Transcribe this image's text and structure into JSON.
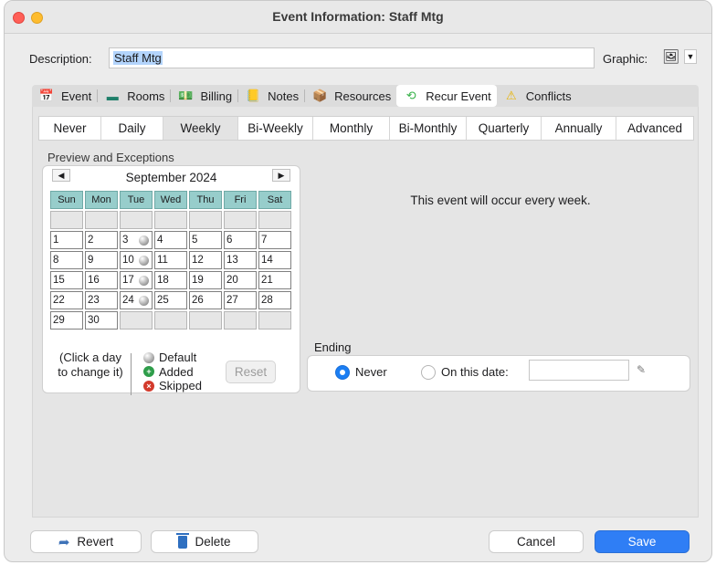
{
  "window": {
    "title": "Event Information: Staff Mtg"
  },
  "description": {
    "label": "Description:",
    "value": "Staff Mtg"
  },
  "graphic": {
    "label": "Graphic:"
  },
  "tabs": [
    {
      "label": "Event",
      "icon": "calendar-31-icon"
    },
    {
      "label": "Rooms",
      "icon": "rooms-icon"
    },
    {
      "label": "Billing",
      "icon": "billing-icon"
    },
    {
      "label": "Notes",
      "icon": "notes-icon"
    },
    {
      "label": "Resources",
      "icon": "resources-icon"
    },
    {
      "label": "Recur Event",
      "icon": "recur-icon",
      "active": true
    },
    {
      "label": "Conflicts",
      "icon": "warning-icon"
    }
  ],
  "recurrence_types": [
    "Never",
    "Daily",
    "Weekly",
    "Bi-Weekly",
    "Monthly",
    "Bi-Monthly",
    "Quarterly",
    "Annually",
    "Advanced"
  ],
  "selected_recurrence": "Weekly",
  "preview": {
    "label": "Preview and Exceptions",
    "month": "September 2024",
    "weekdays": [
      "Sun",
      "Mon",
      "Tue",
      "Wed",
      "Thu",
      "Fri",
      "Sat"
    ],
    "weeks": [
      [
        "",
        "",
        "",
        "",
        "",
        "",
        ""
      ],
      [
        "1",
        "2",
        "3",
        "4",
        "5",
        "6",
        "7"
      ],
      [
        "8",
        "9",
        "10",
        "11",
        "12",
        "13",
        "14"
      ],
      [
        "15",
        "16",
        "17",
        "18",
        "19",
        "20",
        "21"
      ],
      [
        "22",
        "23",
        "24",
        "25",
        "26",
        "27",
        "28"
      ],
      [
        "29",
        "30",
        "",
        "",
        "",
        "",
        ""
      ]
    ],
    "marked_days": [
      "3",
      "10",
      "17",
      "24"
    ],
    "hint": "(Click a day to change it)",
    "legend": {
      "default": "Default",
      "added": "Added",
      "skipped": "Skipped"
    },
    "reset_label": "Reset"
  },
  "occurrence_text": "This event will occur every week.",
  "ending": {
    "label": "Ending",
    "never_label": "Never",
    "on_date_label": "On this date:",
    "date_value": "",
    "selected": "never"
  },
  "footer": {
    "revert": "Revert",
    "delete": "Delete",
    "cancel": "Cancel",
    "save": "Save"
  },
  "colors": {
    "accent": "#2f7ef5",
    "weekday_header": "#97cdcb",
    "close": "#ff5f57",
    "minimize": "#febc2e"
  }
}
